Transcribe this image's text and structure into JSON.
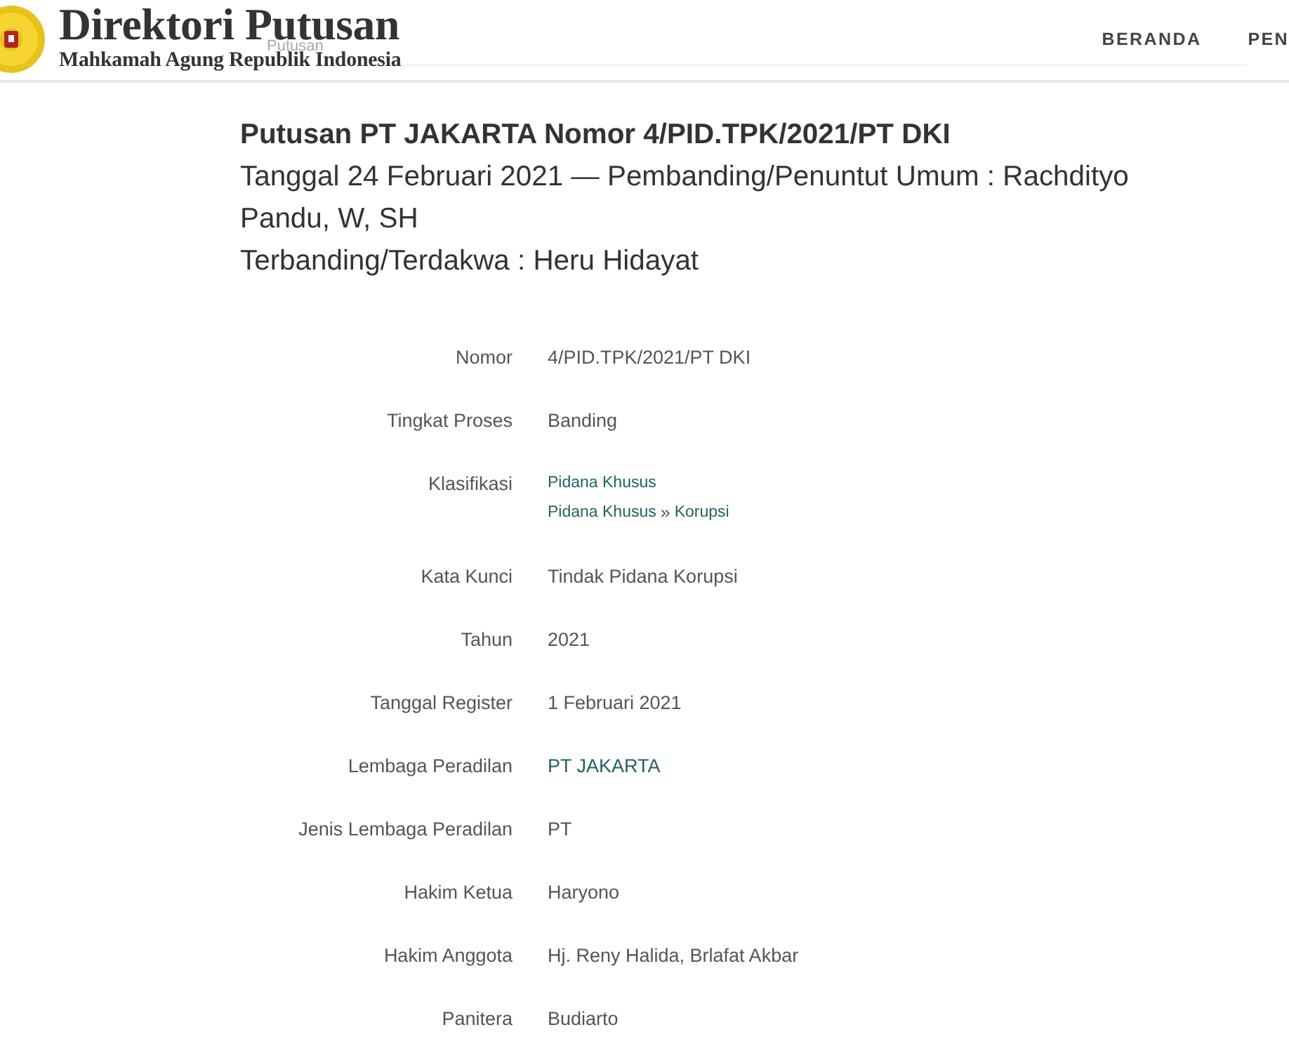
{
  "header": {
    "title": "Direktori Putusan",
    "subtitle": "Mahkamah Agung Republik Indonesia",
    "faded_label": "Putusan",
    "nav": [
      {
        "label": "BERANDA"
      },
      {
        "label": "PEN"
      }
    ]
  },
  "heading": {
    "title": "Putusan PT JAKARTA Nomor 4/PID.TPK/2021/PT DKI",
    "lines": [
      "Tanggal 24 Februari 2021 — Pembanding/Penuntut Umum : Rachdityo Pandu, W, SH",
      "Terbanding/Terdakwa : Heru Hidayat"
    ]
  },
  "details": [
    {
      "label": "Nomor",
      "kind": "text",
      "value": "4/PID.TPK/2021/PT DKI"
    },
    {
      "label": "Tingkat Proses",
      "kind": "text",
      "value": "Banding"
    },
    {
      "label": "Klasifikasi",
      "kind": "links",
      "lines": [
        {
          "items": [
            {
              "kind": "link",
              "text": "Pidana Khusus"
            }
          ]
        },
        {
          "items": [
            {
              "kind": "link",
              "text": "Pidana Khusus"
            },
            {
              "kind": "separator",
              "text": "»"
            },
            {
              "kind": "link",
              "text": "Korupsi"
            }
          ]
        }
      ]
    },
    {
      "label": "Kata Kunci",
      "kind": "text",
      "value": "Tindak Pidana Korupsi"
    },
    {
      "label": "Tahun",
      "kind": "text",
      "value": "2021"
    },
    {
      "label": "Tanggal Register",
      "kind": "text",
      "value": "1 Februari 2021"
    },
    {
      "label": "Lembaga Peradilan",
      "kind": "link",
      "value": "PT JAKARTA"
    },
    {
      "label": "Jenis Lembaga Peradilan",
      "kind": "text",
      "value": "PT"
    },
    {
      "label": "Hakim Ketua",
      "kind": "text",
      "value": "Haryono"
    },
    {
      "label": "Hakim Anggota",
      "kind": "text",
      "value": "Hj. Reny Halida, Brlafat Akbar"
    },
    {
      "label": "Panitera",
      "kind": "text",
      "value": "Budiarto"
    }
  ]
}
